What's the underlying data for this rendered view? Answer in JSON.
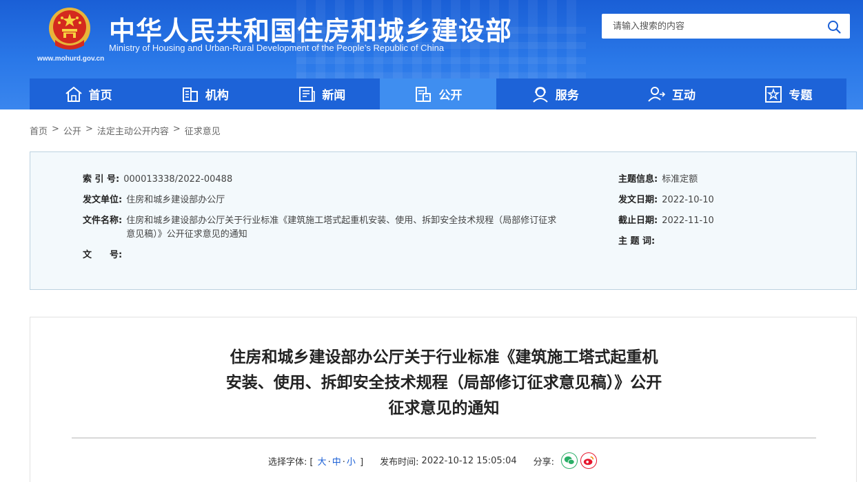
{
  "header": {
    "title": "中华人民共和国住房和城乡建设部",
    "subtitle": "Ministry of Housing and Urban-Rural Development of the People’s Republic of China",
    "url": "www.mohurd.gov.cn",
    "search_placeholder": "请输入搜索的内容"
  },
  "nav": {
    "items": [
      {
        "label": "首页",
        "icon": "home-icon"
      },
      {
        "label": "机构",
        "icon": "building-icon"
      },
      {
        "label": "新闻",
        "icon": "news-icon"
      },
      {
        "label": "公开",
        "icon": "disclosure-icon",
        "active": true
      },
      {
        "label": "服务",
        "icon": "service-icon"
      },
      {
        "label": "互动",
        "icon": "interaction-icon"
      },
      {
        "label": "专题",
        "icon": "star-topic-icon"
      }
    ]
  },
  "breadcrumb": [
    "首页",
    "公开",
    "法定主动公开内容",
    "征求意见"
  ],
  "info": {
    "index_label": "索 引 号:",
    "index_value": "000013338/2022-00488",
    "unit_label": "发文单位:",
    "unit_value": "住房和城乡建设部办公厅",
    "filename_label": "文件名称:",
    "filename_value": "住房和城乡建设部办公厅关于行业标准《建筑施工塔式起重机安装、使用、拆卸安全技术规程（局部修订征求意见稿）》公开征求意见的通知",
    "docno_label": "文　　号:",
    "docno_value": "",
    "topic_label": "主题信息:",
    "topic_value": "标准定额",
    "issue_date_label": "发文日期:",
    "issue_date_value": "2022-10-10",
    "deadline_label": "截止日期:",
    "deadline_value": "2022-11-10",
    "keywords_label": "主 题 词:",
    "keywords_value": ""
  },
  "article": {
    "title": "住房和城乡建设部办公厅关于行业标准《建筑施工塔式起重机安装、使用、拆卸安全技术规程（局部修订征求意见稿）》公开征求意见的通知",
    "font_label": "选择字体:",
    "font_open": "[",
    "font_large": "大",
    "font_medium": "中",
    "font_small": "小",
    "font_close": "]",
    "dot": "·",
    "publish_label": "发布时间:",
    "publish_time": "2022-10-12 15:05:04",
    "share_label": "分享:"
  },
  "colors": {
    "header_blue": "#1a5fd6",
    "nav_active": "#3f8ef0",
    "wechat_green": "#2aae67",
    "weibo_red": "#e6162d"
  }
}
